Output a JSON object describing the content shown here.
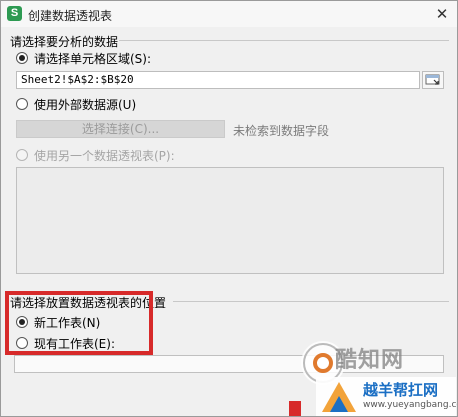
{
  "window": {
    "title": "创建数据透视表",
    "app_icon_letter": "S",
    "app_icon_color": "#2d9a52",
    "close_glyph": "✕"
  },
  "source_section": {
    "label": "请选择要分析的数据",
    "option_range": {
      "label": "请选择单元格区域(S):",
      "checked": true
    },
    "range_value": "Sheet2!$A$2:$B$20",
    "option_external": {
      "label": "使用外部数据源(U)",
      "checked": false
    },
    "connect_button_label": "选择连接(C)...",
    "connect_status": "未检索到数据字段",
    "option_other_pivot": {
      "label": "使用另一个数据透视表(P):",
      "checked": false,
      "disabled": true
    }
  },
  "location_section": {
    "label": "请选择放置数据透视表的位置",
    "option_new_sheet": {
      "label": "新工作表(N)",
      "checked": true
    },
    "option_existing_sheet": {
      "label": "现有工作表(E):",
      "checked": false
    }
  },
  "watermarks": {
    "brand_text": "酷知网",
    "site_name": "越羊帮扛网",
    "site_url": "www.yueyangbang.com"
  },
  "colors": {
    "highlight": "#d72a2a",
    "link_blue": "#1b6fc4"
  }
}
